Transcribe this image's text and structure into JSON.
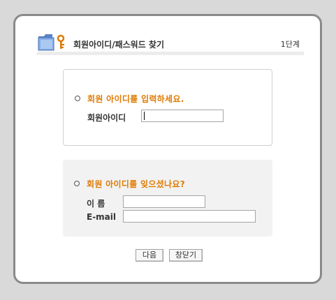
{
  "header": {
    "title": "회원아이디/패스워드 찾기",
    "step": "1단계",
    "logo_icon": "folder-key-icon"
  },
  "find_id": {
    "question": "회원 아이디를 입력하세요.",
    "id_label": "회원아이디",
    "id_value": ""
  },
  "forgot_id": {
    "question": "회원 아이디를 잊으셨나요?",
    "name_label": "이 름",
    "name_value": "",
    "email_label": "E-mail",
    "email_value": ""
  },
  "buttons": {
    "next": "다음",
    "close": "창닫기"
  },
  "colors": {
    "accent": "#e07a00",
    "frame_border": "#8a8a8a",
    "page_bg": "#d9d9d9"
  }
}
